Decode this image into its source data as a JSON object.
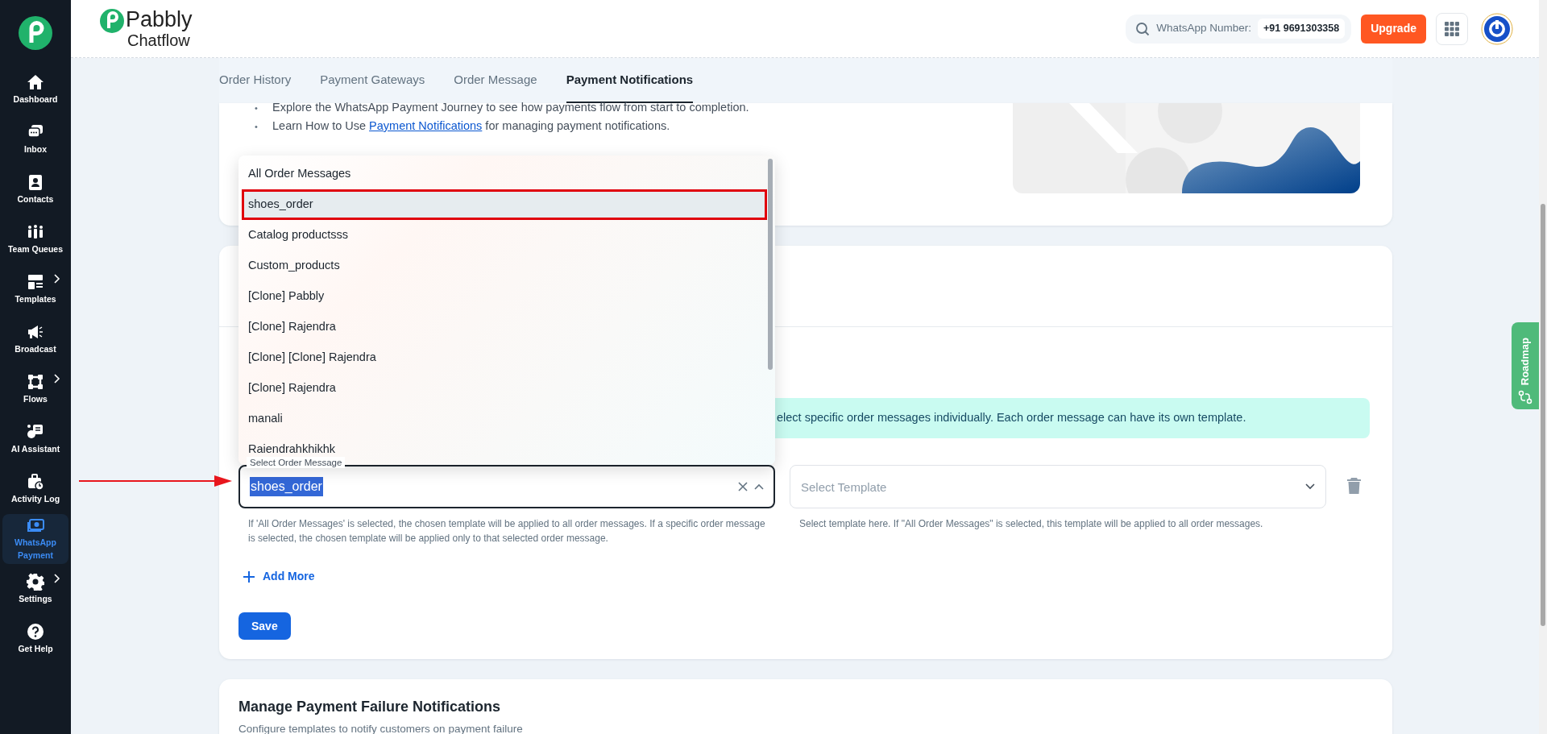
{
  "sidebar": {
    "items": [
      {
        "label": "Dashboard",
        "selected": false,
        "submenu": false
      },
      {
        "label": "Inbox",
        "selected": false,
        "submenu": false
      },
      {
        "label": "Contacts",
        "selected": false,
        "submenu": false
      },
      {
        "label": "Team Queues",
        "selected": false,
        "submenu": false
      },
      {
        "label": "Templates",
        "selected": false,
        "submenu": true
      },
      {
        "label": "Broadcast",
        "selected": false,
        "submenu": false
      },
      {
        "label": "Flows",
        "selected": false,
        "submenu": true
      },
      {
        "label": "AI Assistant",
        "selected": false,
        "submenu": false
      },
      {
        "label": "Activity Log",
        "selected": false,
        "submenu": false
      },
      {
        "label": "WhatsApp Payment",
        "selected": true,
        "submenu": false
      },
      {
        "label": "Settings",
        "selected": false,
        "submenu": true
      },
      {
        "label": "Get Help",
        "selected": false,
        "submenu": false
      }
    ]
  },
  "header": {
    "logo": {
      "name": "Pabbly",
      "product": "Chatflow"
    },
    "whatsapp": {
      "label": "WhatsApp Number:",
      "number": "+91 9691303358"
    },
    "upgrade_button": "Upgrade"
  },
  "tabs": [
    {
      "label": "Order History",
      "selected": false
    },
    {
      "label": "Payment Gateways",
      "selected": false
    },
    {
      "label": "Order Message",
      "selected": false
    },
    {
      "label": "Payment Notifications",
      "selected": true
    }
  ],
  "intro": {
    "bullets": [
      {
        "marker": "•",
        "before": "Explore the WhatsApp Payment Journey to see how payments flow from start to completion."
      },
      {
        "marker": "•",
        "before": "Learn How to Use ",
        "link": "Payment Notifications",
        "after": " for managing payment notifications."
      }
    ]
  },
  "notifications": {
    "alert": "elect specific order messages individually. Each order message can have its own template.",
    "order_field": {
      "label": "Select Order Message",
      "value": "shoes_order",
      "help": "If 'All Order Messages' is selected, the chosen template will be applied to all order messages. If a specific order message is selected, the chosen template will be applied only to that selected order message."
    },
    "options": [
      {
        "label": "All Order Messages",
        "selected": false
      },
      {
        "label": "shoes_order",
        "selected": true
      },
      {
        "label": "Catalog productsss",
        "selected": false
      },
      {
        "label": "Custom_products",
        "selected": false
      },
      {
        "label": "[Clone] Pabbly",
        "selected": false
      },
      {
        "label": "[Clone] Rajendra",
        "selected": false
      },
      {
        "label": "[Clone] [Clone] Rajendra",
        "selected": false
      },
      {
        "label": "[Clone] Rajendra",
        "selected": false
      },
      {
        "label": "manali",
        "selected": false
      },
      {
        "label": "Raiendrahkhikhk",
        "selected": false
      }
    ],
    "template_field": {
      "placeholder": "Select Template",
      "help": "Select template here. If \"All Order Messages\" is selected, this template will be applied to all order messages."
    },
    "add_more": "Add More",
    "save_button": "Save"
  },
  "failure": {
    "title": "Manage Payment Failure Notifications",
    "subtitle": "Configure templates to notify customers on payment failure"
  },
  "roadmap": {
    "label": "Roadmap"
  }
}
